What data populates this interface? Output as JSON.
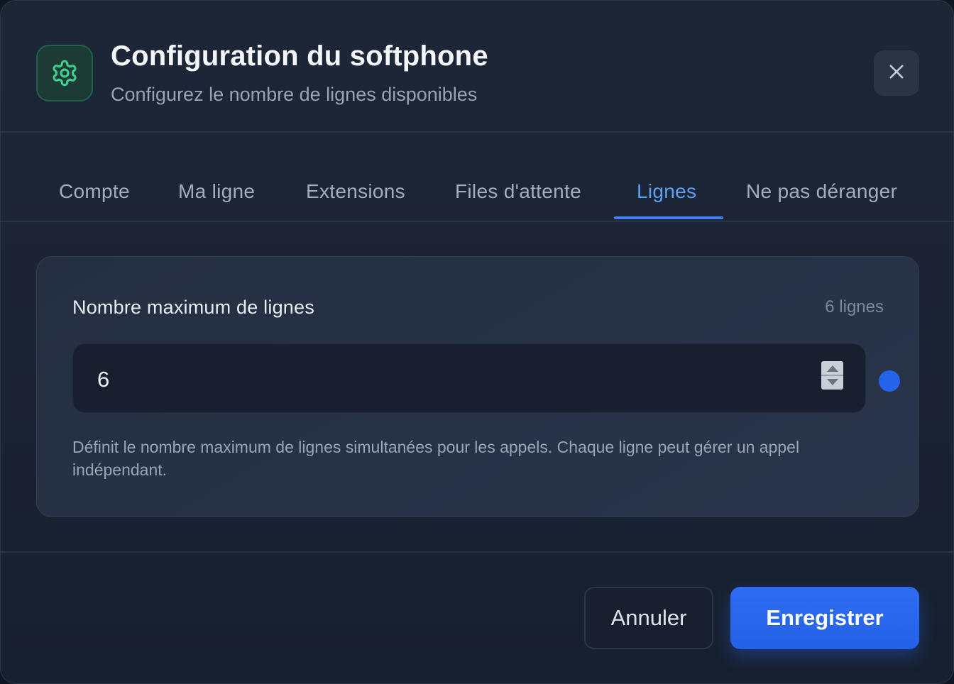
{
  "dialog": {
    "title": "Configuration du softphone",
    "subtitle": "Configurez le nombre de lignes disponibles",
    "header_icon": "gear-icon",
    "close_icon": "close-icon"
  },
  "tabs": [
    {
      "label": "Compte",
      "active": false
    },
    {
      "label": "Ma ligne",
      "active": false
    },
    {
      "label": "Extensions",
      "active": false
    },
    {
      "label": "Files d'attente",
      "active": false
    },
    {
      "label": "Lignes",
      "active": true
    },
    {
      "label": "Ne pas déranger",
      "active": false
    }
  ],
  "lines": {
    "label": "Nombre maximum de lignes",
    "count_text": "6 lignes",
    "value": "6",
    "help": "Définit le nombre maximum de lignes simultanées pour les appels. Chaque ligne peut gérer un appel indépendant."
  },
  "footer": {
    "cancel_label": "Annuler",
    "save_label": "Enregistrer"
  },
  "colors": {
    "accent": "#3b82f6",
    "primary_button": "#2563eb",
    "icon_green": "#3ecf8e",
    "background": "#1d2637"
  }
}
